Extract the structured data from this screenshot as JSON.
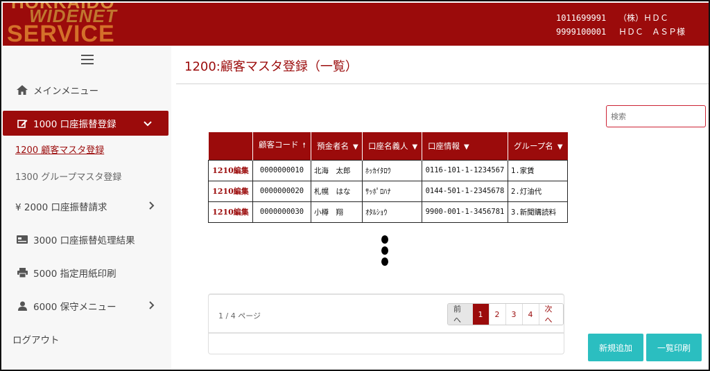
{
  "header": {
    "logo_lines": [
      "HOKKAIDO",
      "WIDENET",
      "SERVICE"
    ],
    "accounts": [
      {
        "code": "1011699991",
        "name": "（株）ＨＤＣ"
      },
      {
        "code": "9999100001",
        "name": "ＨＤＣ　ＡＳＰ様"
      }
    ]
  },
  "sidebar": {
    "menu_icon": "hamburger-icon",
    "items": [
      {
        "icon": "home-icon",
        "label": "メインメニュー"
      },
      {
        "icon": "edit-icon",
        "label": "1000 口座振替登録",
        "expanded": true
      },
      {
        "label": "1200 顧客マスタ登録",
        "current": true
      },
      {
        "label": "1300 グループマスタ登録"
      },
      {
        "icon": "yen-icon",
        "label": "¥ 2000 口座振替請求"
      },
      {
        "icon": "card-icon",
        "label": "3000 口座振替処理結果"
      },
      {
        "icon": "printer-icon",
        "label": "5000 指定用紙印刷"
      },
      {
        "icon": "user-icon",
        "label": "6000 保守メニュー"
      }
    ],
    "logout": "ログアウト"
  },
  "main": {
    "title": "1200:顧客マスタ登録（一覧）",
    "search_placeholder": "検索",
    "table": {
      "headers": [
        "",
        "顧客コード",
        "預金者名",
        "口座名義人",
        "口座情報",
        "グループ名"
      ],
      "sort": [
        "",
        "up",
        "down",
        "down",
        "down",
        "down"
      ],
      "rows": [
        [
          "1210編集",
          "0000000010",
          "北海　太郎",
          "ﾎｯｶｲﾀﾛｳ",
          "0116-101-1-1234567",
          "1.家賃"
        ],
        [
          "1210編集",
          "0000000020",
          "札幌　はな",
          "ｻｯﾎﾟﾛﾊﾅ",
          "0144-501-1-2345678",
          "2.灯油代"
        ],
        [
          "1210編集",
          "0000000030",
          "小樽　翔",
          "ｵﾀﾙｼｮｳ",
          "9900-001-1-3456781",
          "3.新聞購読料"
        ]
      ]
    },
    "pagination": {
      "info": "1 / 4 ページ",
      "prev": "前へ",
      "pages": [
        "1",
        "2",
        "3",
        "4"
      ],
      "current": "1",
      "next": "次へ"
    },
    "buttons": {
      "new": "新規追加",
      "print": "一覧印刷"
    }
  }
}
